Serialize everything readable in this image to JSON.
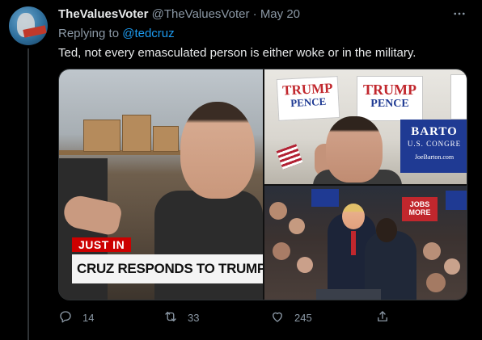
{
  "tweet": {
    "display_name": "TheValuesVoter",
    "handle": "@TheValuesVoter",
    "separator": "·",
    "date": "May 20",
    "replying_prefix": "Replying to ",
    "replying_to": "@tedcruz",
    "text": "Ted, not every emasculated person is either woke or in the military.",
    "more_icon": "more-horizontal-icon"
  },
  "media": {
    "left": {
      "chyron_small": "JUST IN",
      "chyron_big": "CRUZ RESPONDS TO TRUMP"
    },
    "top_right": {
      "sign_1_top": "TRUMP",
      "sign_1_bottom": "PENCE",
      "sign_2_top": "TRUMP",
      "sign_2_bottom": "PENCE",
      "barton_1": "BARTO",
      "barton_2": "U.S. CONGRE",
      "barton_3": "JoeBarton.com"
    },
    "bottom_right": {
      "sign_a": "JOBS",
      "sign_b": "MORE"
    }
  },
  "actions": {
    "reply": {
      "icon": "reply-icon",
      "count": "14"
    },
    "retweet": {
      "icon": "retweet-icon",
      "count": "33"
    },
    "like": {
      "icon": "heart-icon",
      "count": "245"
    },
    "share": {
      "icon": "share-icon",
      "count": ""
    }
  },
  "colors": {
    "background": "#000000",
    "primary_text": "#e7e9ea",
    "secondary_text": "#8b98a5",
    "link": "#1d9bf0"
  }
}
